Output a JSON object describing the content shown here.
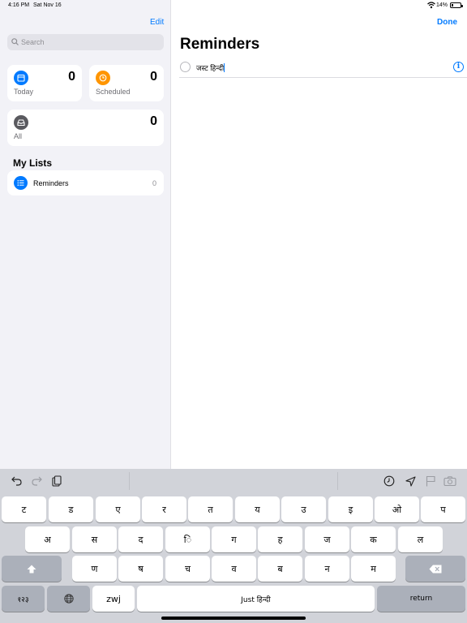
{
  "status": {
    "time": "4:16 PM",
    "date": "Sat Nov 16",
    "battery": "14%"
  },
  "sidebar": {
    "edit_label": "Edit",
    "search_placeholder": "Search",
    "smart_lists": [
      {
        "label": "Today",
        "count": "0",
        "color": "#007aff",
        "icon": "calendar-icon"
      },
      {
        "label": "Scheduled",
        "count": "0",
        "color": "#ff9500",
        "icon": "clock-icon"
      },
      {
        "label": "All",
        "count": "0",
        "color": "#5a5a5f",
        "icon": "tray-icon"
      }
    ],
    "my_lists_title": "My Lists",
    "lists": [
      {
        "name": "Reminders",
        "count": "0",
        "color": "#007aff",
        "icon": "list-bullet-icon"
      }
    ]
  },
  "main": {
    "done_label": "Done",
    "title": "Reminders",
    "items": [
      {
        "text": "जस्ट हिन्दी",
        "info_icon": "info-icon"
      }
    ]
  },
  "keyboard": {
    "toolbar_icons": [
      "undo-icon",
      "redo-icon",
      "paste-icon",
      "clock-icon",
      "location-icon",
      "flag-icon",
      "camera-icon"
    ],
    "row1": [
      "ट",
      "ड",
      "ए",
      "र",
      "त",
      "य",
      "उ",
      "इ",
      "ओ",
      "प"
    ],
    "row2": [
      "अ",
      "स",
      "द",
      "ि",
      "ग",
      "ह",
      "ज",
      "क",
      "ल"
    ],
    "row3": [
      "ण",
      "ष",
      "च",
      "व",
      "ब",
      "न",
      "म"
    ],
    "numbers_label": "१२३",
    "zwj_label": "zwj",
    "space_label": "Just हिन्दी",
    "return_label": "return"
  }
}
